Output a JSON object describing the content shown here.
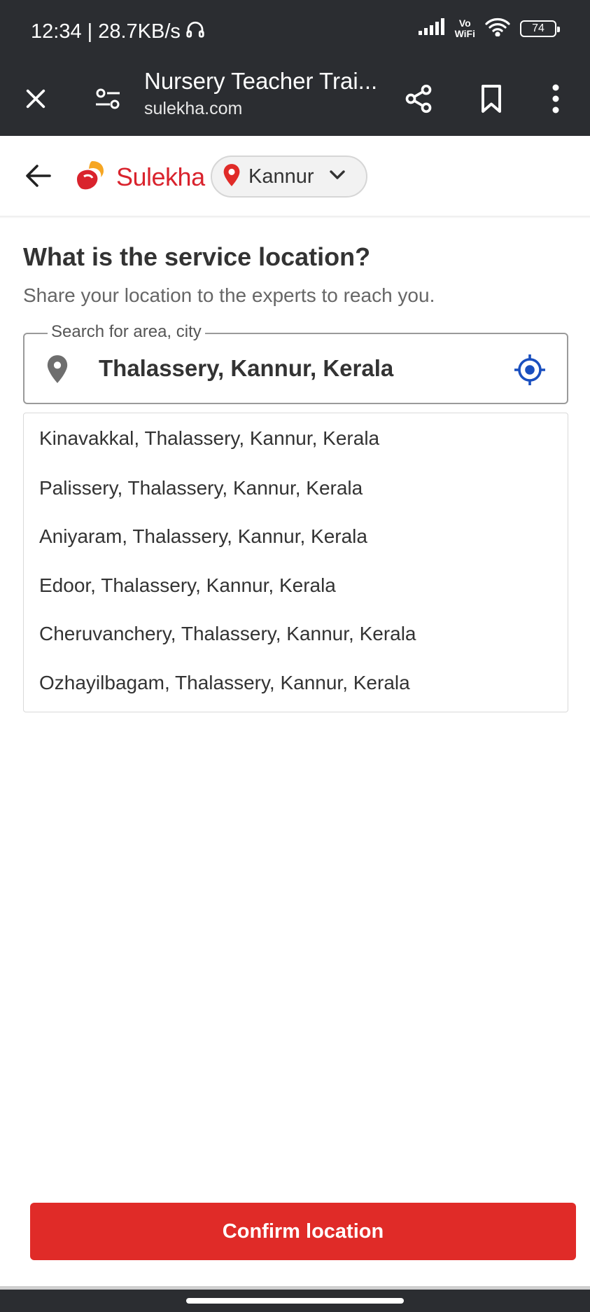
{
  "status_bar": {
    "time_speed": "12:34 | 28.7KB/s",
    "vowifi_top": "Vo",
    "vowifi_bottom": "WiFi",
    "battery": "74"
  },
  "browser": {
    "page_title": "Nursery Teacher Trai...",
    "url": "sulekha.com"
  },
  "header": {
    "logo_text": "Sulekha",
    "city": "Kannur",
    "brand_color": "#d9232d"
  },
  "main": {
    "title": "What is the service location?",
    "subtitle": "Share your location to the experts to reach you.",
    "search": {
      "label": "Search for area, city",
      "value": "Thalassery, Kannur, Kerala"
    },
    "suggestions": [
      "Kinavakkal, Thalassery, Kannur, Kerala",
      "Palissery, Thalassery, Kannur, Kerala",
      "Aniyaram, Thalassery, Kannur, Kerala",
      "Edoor, Thalassery, Kannur, Kerala",
      "Cheruvanchery, Thalassery, Kannur, Kerala",
      "Ozhayilbagam, Thalassery, Kannur, Kerala"
    ]
  },
  "footer": {
    "confirm_label": "Confirm location",
    "confirm_color": "#e02b28"
  },
  "icons": [
    "headphones-icon",
    "signal-icon",
    "wifi-icon",
    "battery-icon",
    "close-icon",
    "page-settings-icon",
    "share-icon",
    "bookmark-icon",
    "more-icon",
    "back-arrow-icon",
    "logo-icon",
    "location-pin-icon",
    "chevron-down-icon",
    "gps-locate-icon"
  ]
}
